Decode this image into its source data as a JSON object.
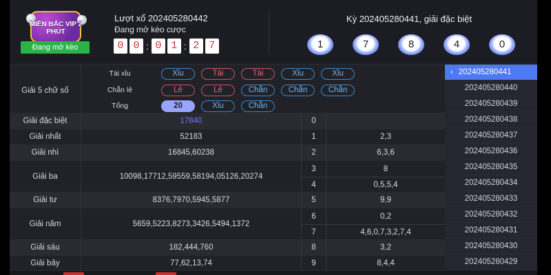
{
  "header": {
    "logo_text": "MIỀN BẮC VIP 2 PHÚT",
    "status": "Đang mở kèo",
    "draw_title": "Lượt xổ 202405280442",
    "draw_subtitle": "Đang mở kèo cược",
    "countdown": [
      "0",
      "0",
      "0",
      "1",
      "2",
      "7"
    ],
    "result_title": "Kỳ 202405280441, giải đặc biệt",
    "result_balls": [
      "1",
      "7",
      "8",
      "4",
      "0"
    ]
  },
  "five_digit": {
    "label": "Giải 5 chữ số",
    "rows": [
      {
        "label": "Tài xỉu",
        "chips": [
          {
            "text": "Xỉu",
            "style": "blue"
          },
          {
            "text": "Tài",
            "style": "red"
          },
          {
            "text": "Tài",
            "style": "red"
          },
          {
            "text": "Xỉu",
            "style": "blue"
          },
          {
            "text": "Xỉu",
            "style": "blue"
          }
        ]
      },
      {
        "label": "Chẵn lẻ",
        "chips": [
          {
            "text": "Lẻ",
            "style": "red"
          },
          {
            "text": "Lẻ",
            "style": "red"
          },
          {
            "text": "Chẵn",
            "style": "blue"
          },
          {
            "text": "Chẵn",
            "style": "blue"
          },
          {
            "text": "Chẵn",
            "style": "blue"
          }
        ]
      },
      {
        "label": "Tổng",
        "chips": [
          {
            "text": "20",
            "style": "fill"
          },
          {
            "text": "Xỉu",
            "style": "blue"
          },
          {
            "text": "Chẵn",
            "style": "blue"
          }
        ]
      }
    ]
  },
  "prizes": [
    {
      "name": "Giải đặc biệt",
      "value": "17840"
    },
    {
      "name": "Giải nhất",
      "value": "52183"
    },
    {
      "name": "Giải nhì",
      "value": "16845,60238"
    },
    {
      "name": "Giải ba",
      "value": "10098,17712,59559,58194,05126,20274"
    },
    {
      "name": "Giải tư",
      "value": "8376,7970,5945,5877"
    },
    {
      "name": "Giải năm",
      "value": "5659,5223,8273,3426,5494,1372"
    },
    {
      "name": "Giải sáu",
      "value": "182,444,760"
    },
    {
      "name": "Giải bảy",
      "value": "77,62,13,74"
    }
  ],
  "tails": [
    {
      "digit": "0",
      "values": ""
    },
    {
      "digit": "1",
      "values": "2,3"
    },
    {
      "digit": "2",
      "values": "6,3,6"
    },
    {
      "digit": "3",
      "values": "8"
    },
    {
      "digit": "4",
      "values": "0,5,5,4"
    },
    {
      "digit": "5",
      "values": "9,9"
    },
    {
      "digit": "6",
      "values": "0,2"
    },
    {
      "digit": "7",
      "values": "4,6,0,7,3,2,7,4"
    },
    {
      "digit": "8",
      "values": "3,2"
    },
    {
      "digit": "9",
      "values": "8,4,4"
    }
  ],
  "draw_list": [
    "202405280441",
    "202405280440",
    "202405280439",
    "202405280438",
    "202405280437",
    "202405280436",
    "202405280435",
    "202405280434",
    "202405280433",
    "202405280432",
    "202405280431",
    "202405280430",
    "202405280429"
  ],
  "colors": {
    "accent": "#4e79f2",
    "status_green": "#2bb34a",
    "red": "#e56470",
    "blue": "#70b4ec",
    "digit_red": "#d0303a"
  },
  "icons": {
    "selected_chevron": "chevron-left-icon"
  }
}
